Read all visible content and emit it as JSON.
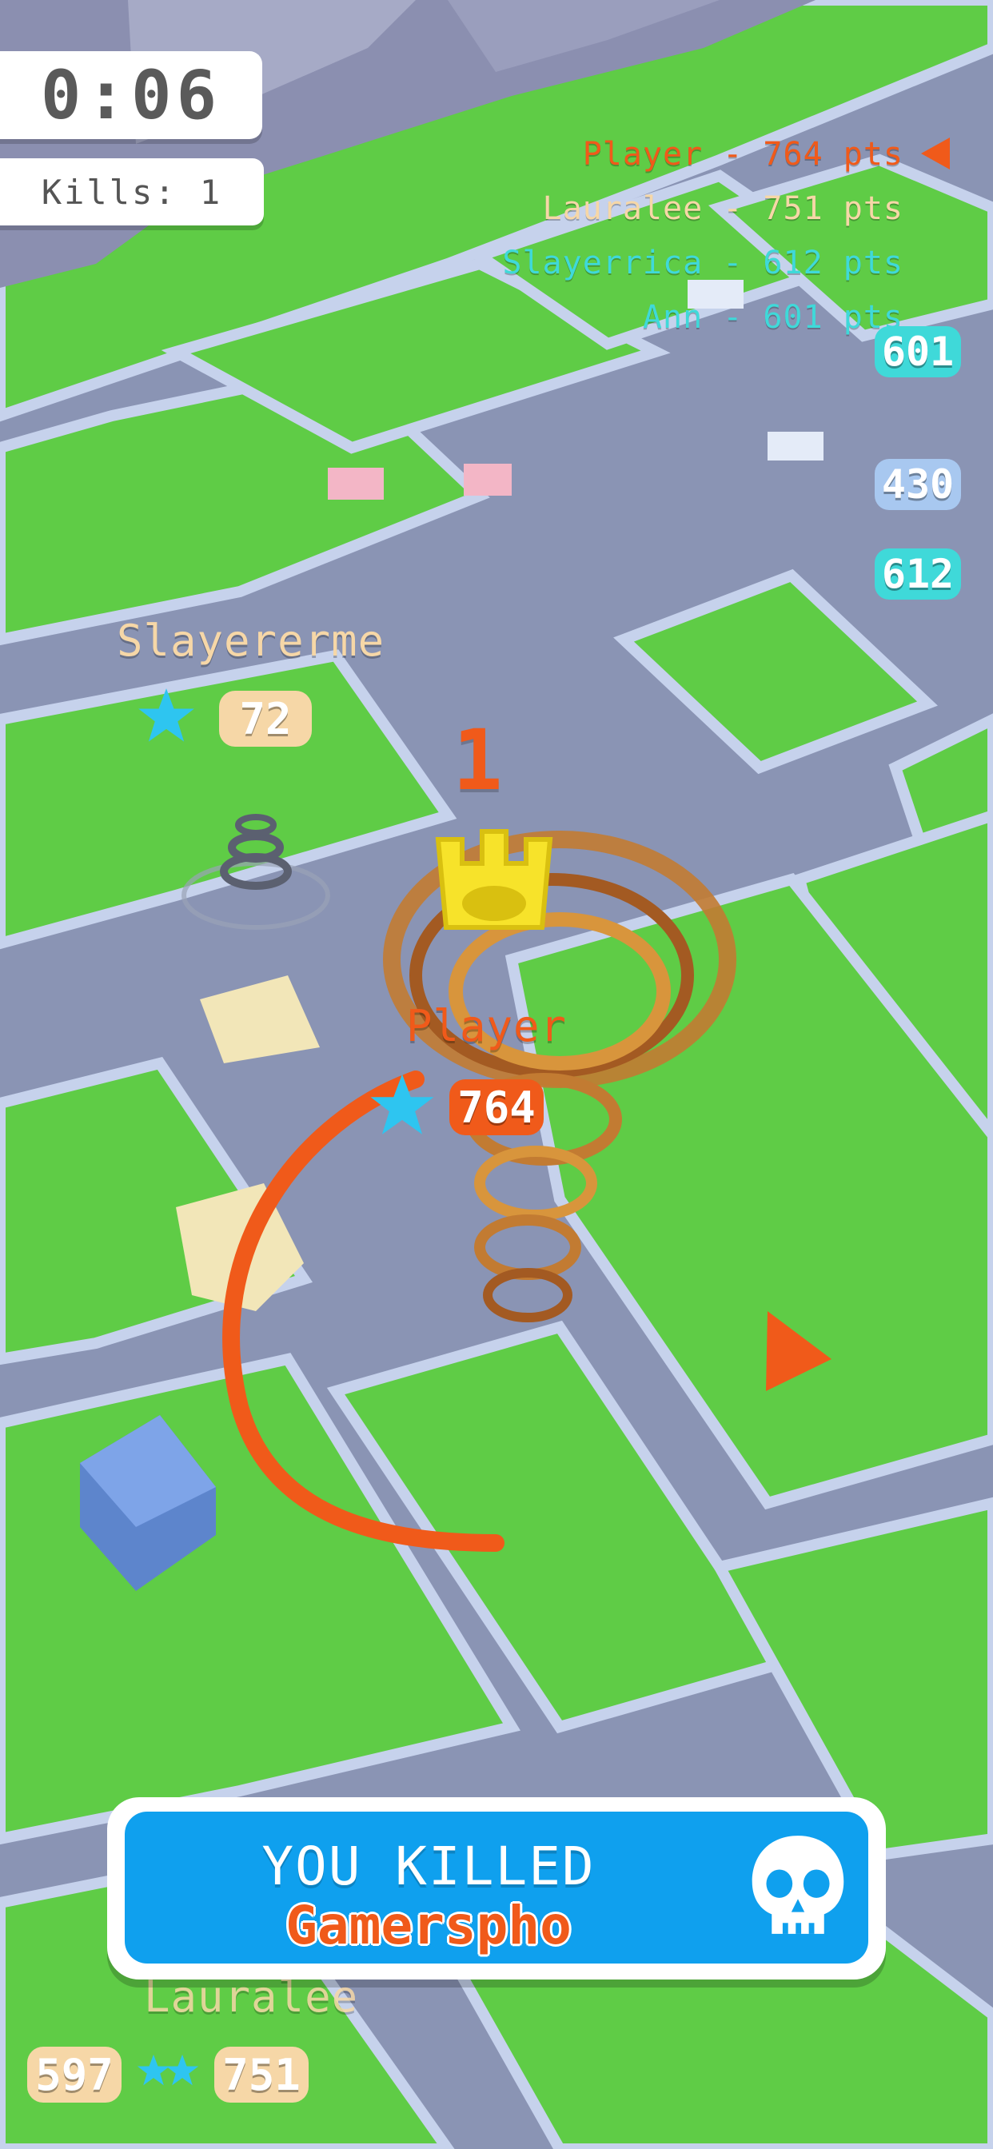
{
  "hud": {
    "timer": "0:06",
    "kills": "Kills: 1"
  },
  "leaderboard": [
    {
      "text": "Player - 764 pts",
      "color": "#f05a1a"
    },
    {
      "text": "Lauralee - 751 pts",
      "color": "#f6d7a7"
    },
    {
      "text": "Slayerrica - 612 pts",
      "color": "#3fd9d9"
    },
    {
      "text": "Ann - 601 pts",
      "color": "#3fd9d9"
    }
  ],
  "edge_tags": [
    {
      "value": "601",
      "color": "#3fd9d9"
    },
    {
      "value": "430",
      "color": "#a8c8f0"
    },
    {
      "value": "612",
      "color": "#3fd9d9"
    }
  ],
  "player": {
    "name": "Player",
    "score": "764",
    "rank": "1",
    "color": "#f05a1a"
  },
  "enemy_top": {
    "name": "Slayererme",
    "score": "72",
    "color": "#f6d7a7"
  },
  "enemy_bottom": {
    "name": "Lauralee",
    "score": "751",
    "left_score": "597",
    "color": "#f6d7a7"
  },
  "kill_banner": {
    "line1": "YOU KILLED",
    "line2": "Gamerspho",
    "accent": "#0fa0ee",
    "icon": "skull-icon"
  },
  "colors": {
    "grass": "#5fcc46",
    "road": "#8a94b4",
    "sidewalk": "#c6d2ec",
    "star": "#2ec5f0",
    "trail": "#f05a1a"
  }
}
